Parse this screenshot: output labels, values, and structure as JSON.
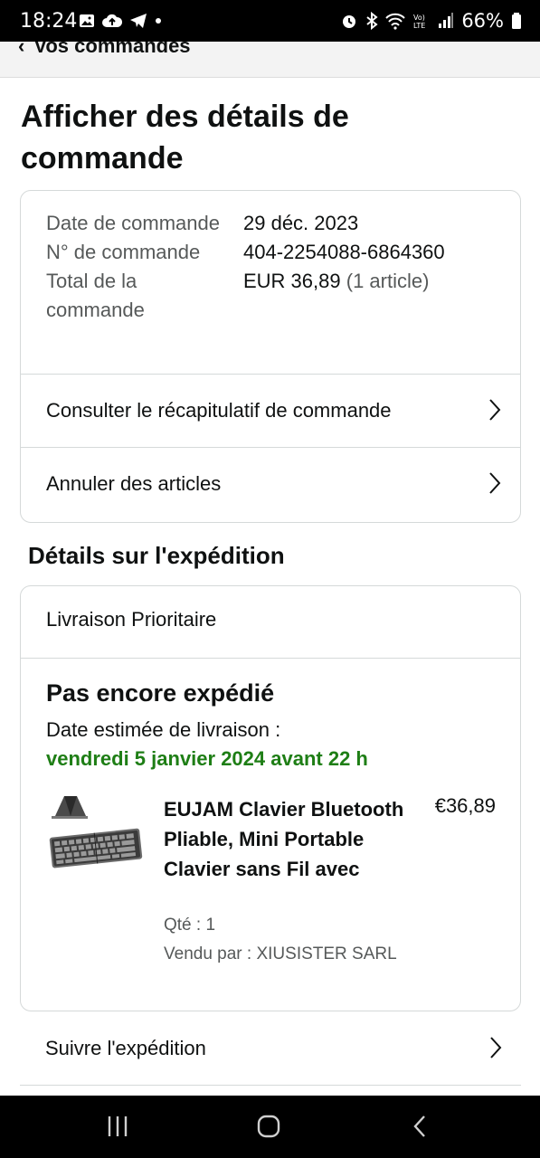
{
  "status_bar": {
    "time": "18:24",
    "battery": "66%"
  },
  "nav": {
    "back_label": "Vos commandes"
  },
  "page": {
    "title": "Afficher des détails de commande"
  },
  "order": {
    "date_label": "Date de commande",
    "date_value": "29 déc. 2023",
    "number_label": "N° de commande",
    "number_value": "404-2254088-6864360",
    "total_label": "Total de la commande",
    "total_value": "EUR 36,89",
    "total_count": "(1 article)"
  },
  "actions": {
    "summary": "Consulter le récapitulatif de commande",
    "cancel": "Annuler des articles"
  },
  "shipping": {
    "section_title": "Détails sur l'expédition",
    "method": "Livraison Prioritaire",
    "status": "Pas encore expédié",
    "estimate_label": "Date estimée de livraison :",
    "estimate_date": "vendredi 5 janvier 2024 avant 22 h",
    "track": "Suivre l'expédition"
  },
  "product": {
    "title": "EUJAM Clavier Bluetooth Pliable, Mini Portable Clavier sans Fil avec",
    "price": "€36,89",
    "qty": "Qté : 1",
    "seller": "Vendu par : XIUSISTER SARL"
  },
  "colors": {
    "green": "#1e7e15",
    "muted": "#565959",
    "border": "#d5d9d9"
  }
}
